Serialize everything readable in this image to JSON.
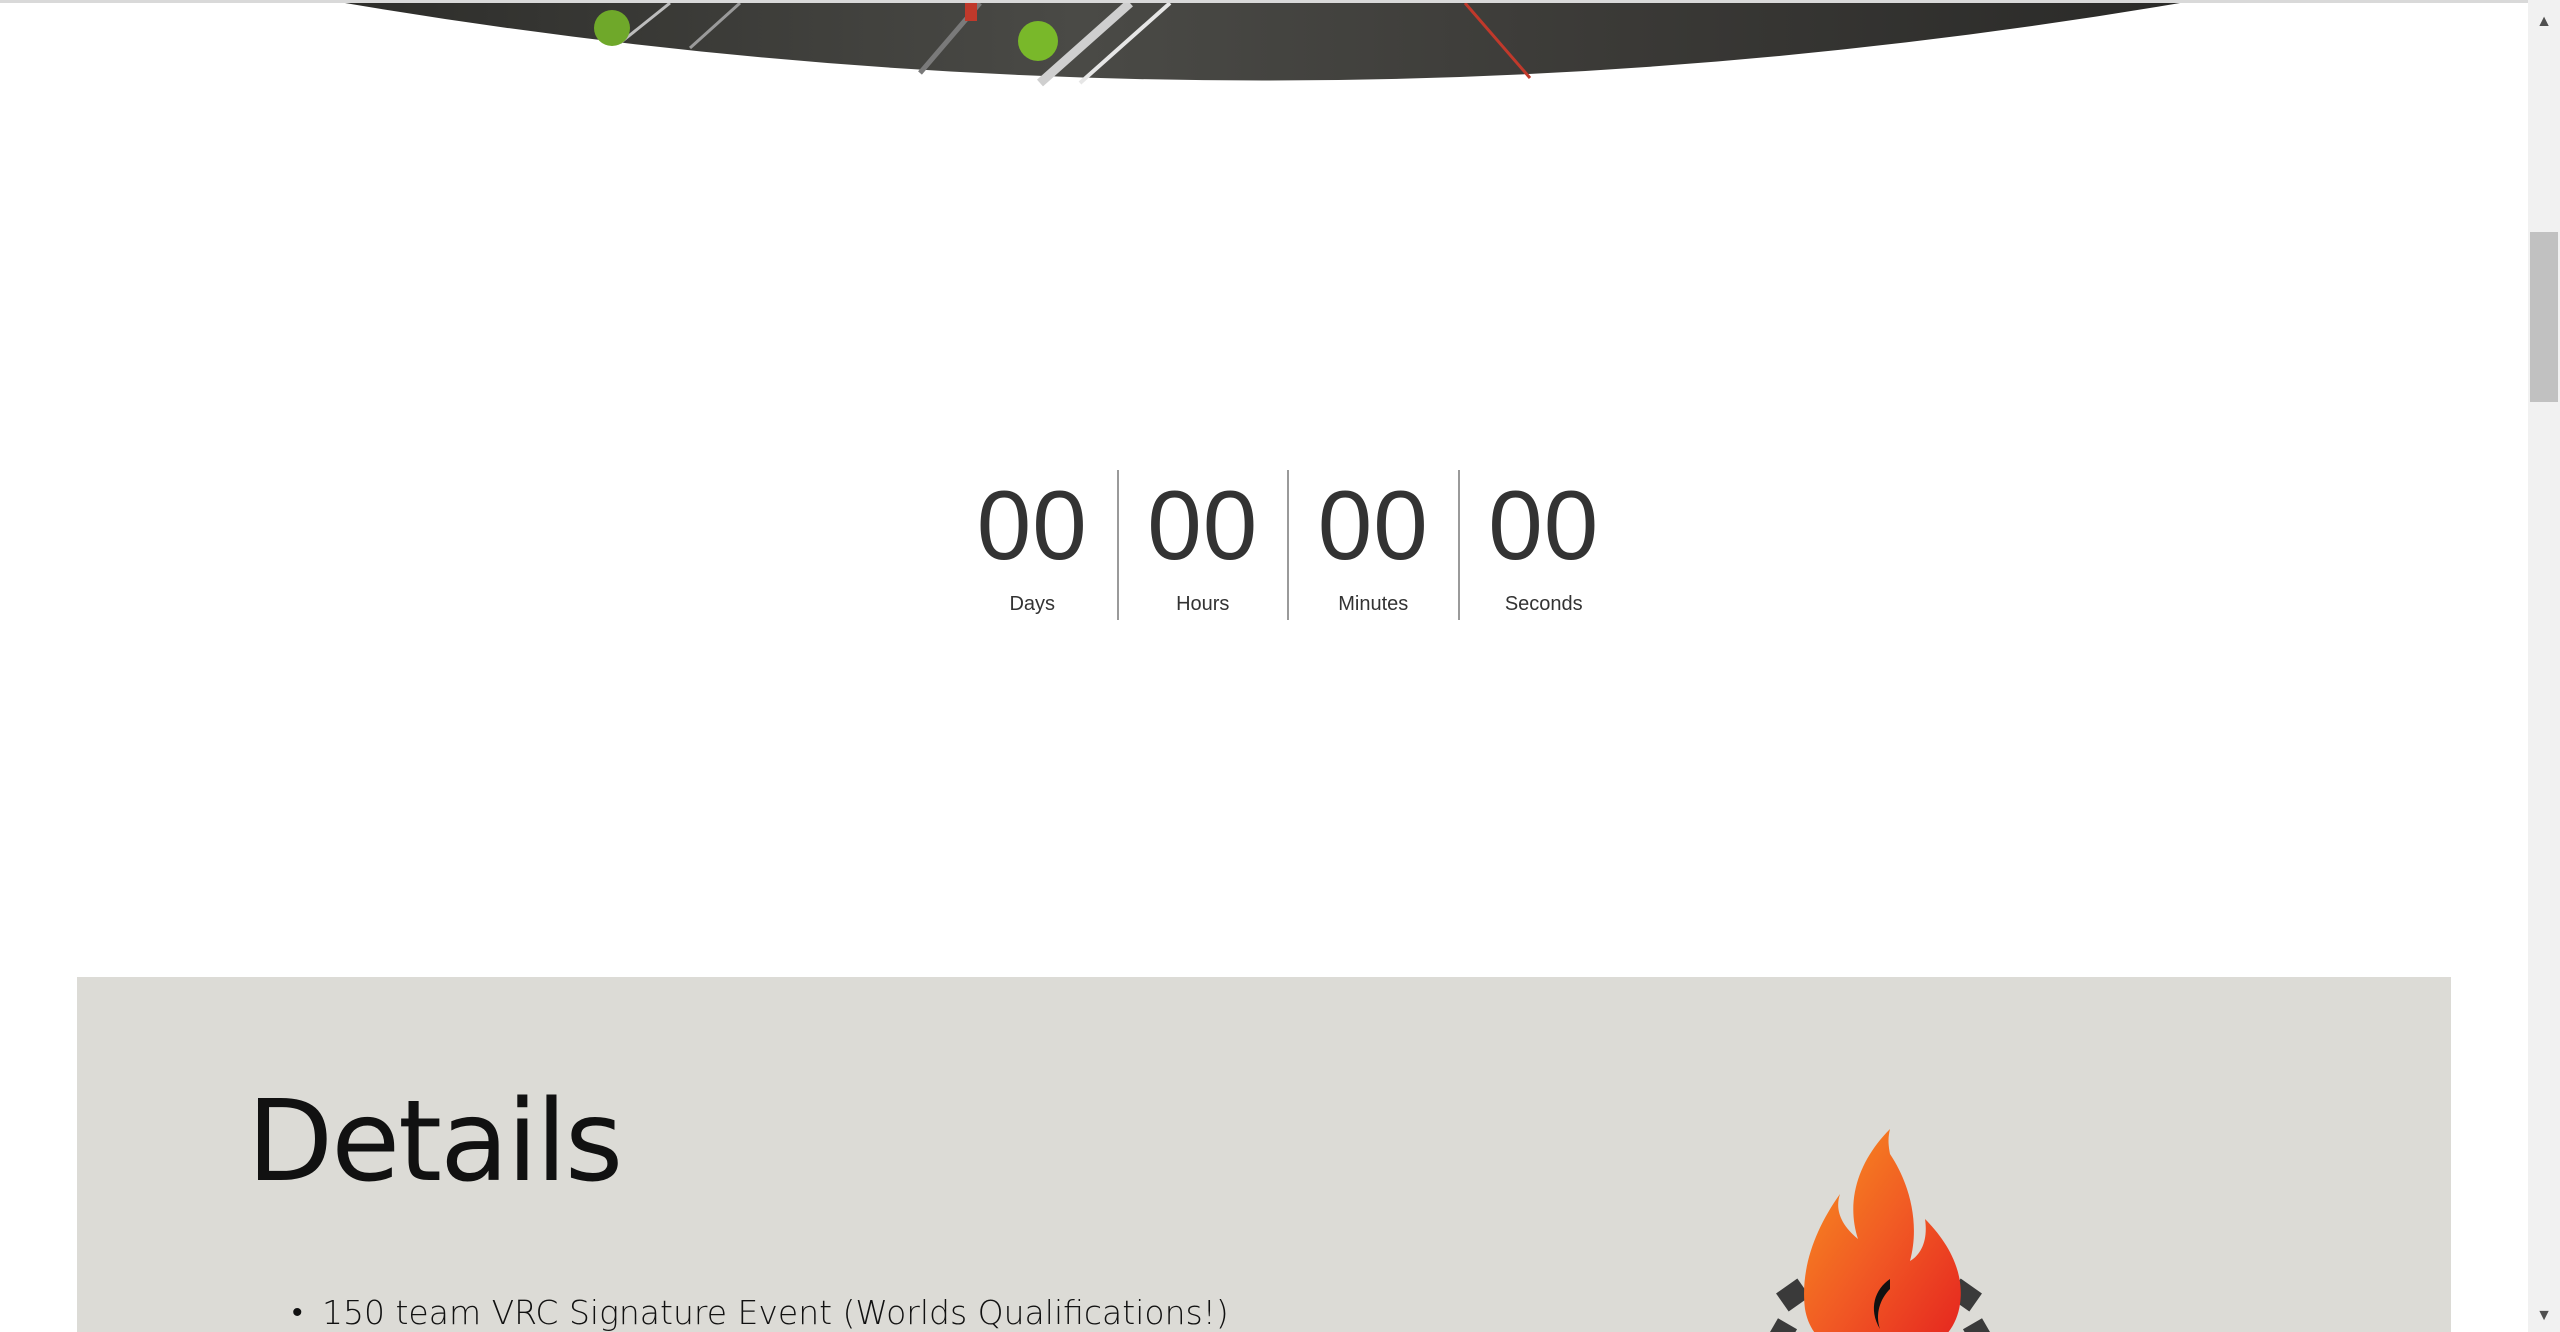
{
  "countdown": {
    "units": [
      {
        "value": "00",
        "label": "Days"
      },
      {
        "value": "00",
        "label": "Hours"
      },
      {
        "value": "00",
        "label": "Minutes"
      },
      {
        "value": "00",
        "label": "Seconds"
      }
    ]
  },
  "details": {
    "title": "Details",
    "items": [
      "150 team VRC Signature Event (Worlds Qualifications!)"
    ]
  },
  "colors": {
    "details_background": "#dcdbd6",
    "countdown_text": "#333333",
    "flame_orange": "#f15a24",
    "flame_red": "#e4211f"
  },
  "icons": {
    "scroll_up": "▲",
    "scroll_down": "▼",
    "bullet": "•"
  },
  "scrollbar": {
    "position_fraction": 0.17
  }
}
